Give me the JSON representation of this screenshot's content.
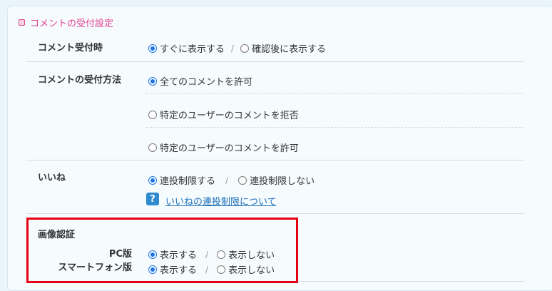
{
  "section": {
    "title": "コメントの受付設定"
  },
  "rows": {
    "receive_timing": {
      "label": "コメント受付時",
      "options": [
        "すぐに表示する",
        "確認後に表示する"
      ],
      "separator": "/",
      "selected": 0
    },
    "receive_method": {
      "label": "コメントの受付方法",
      "options": [
        "全てのコメントを許可",
        "特定のユーザーのコメントを拒否",
        "特定のユーザーのコメントを許可"
      ],
      "selected": 0
    },
    "likes": {
      "label": "いいね",
      "options": [
        "連投制限する",
        "連投制限しない"
      ],
      "separator": "/",
      "selected": 0,
      "help_icon": "?",
      "help_link": "いいねの連投制限について"
    },
    "captcha": {
      "label": "画像認証",
      "pc": {
        "label": "PC版",
        "options": [
          "表示する",
          "表示しない"
        ],
        "separator": "/",
        "selected": 0
      },
      "smartphone": {
        "label": "スマートフォン版",
        "options": [
          "表示する",
          "表示しない"
        ],
        "separator": "/",
        "selected": 0
      }
    }
  },
  "colors": {
    "accent": "#e0428e",
    "radio": "#1a73e8",
    "link": "#1b6fb8",
    "highlight_box": "#e50012"
  }
}
